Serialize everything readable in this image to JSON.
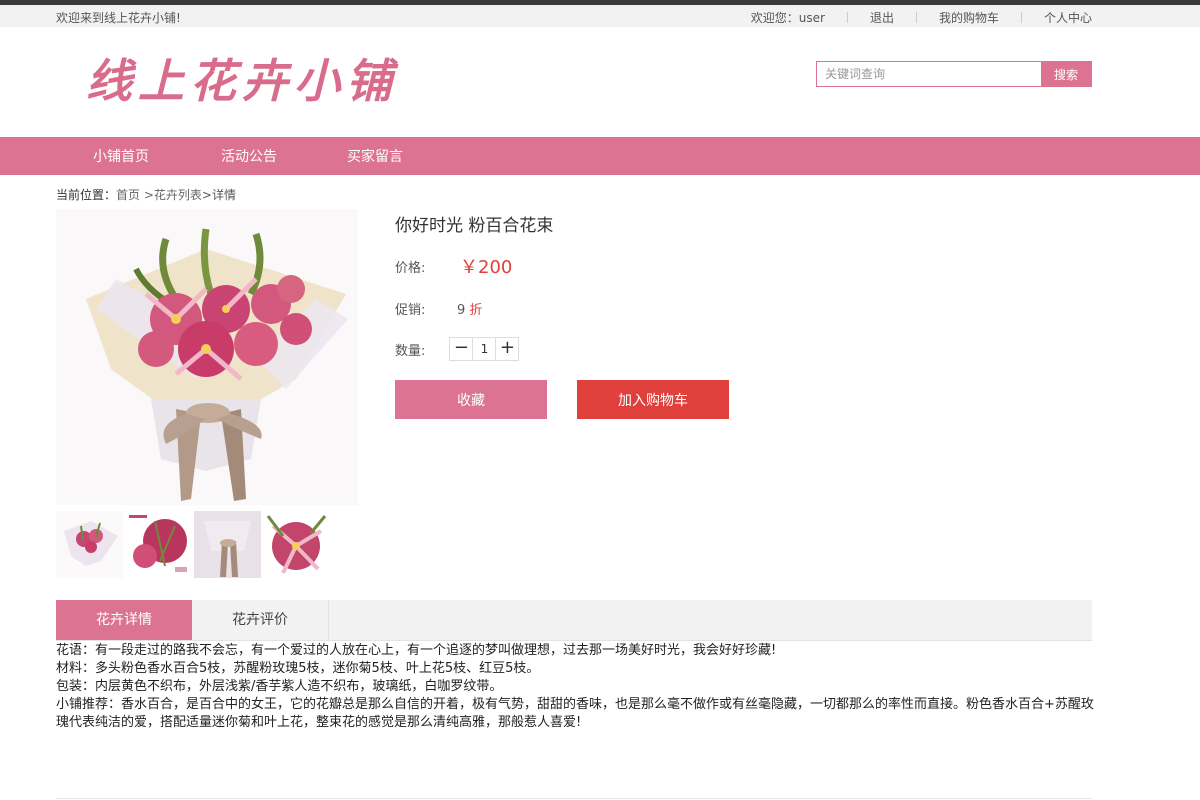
{
  "topbar": {
    "welcome": "欢迎来到线上花卉小铺!",
    "user_greeting": "欢迎您：user",
    "logout": "退出",
    "cart": "我的购物车",
    "account": "个人中心"
  },
  "header": {
    "logo_text": "线上花卉小铺",
    "search": {
      "placeholder": "关键词查询",
      "button": "搜索"
    }
  },
  "nav": {
    "items": [
      "小铺首页",
      "活动公告",
      "买家留言"
    ]
  },
  "breadcrumb": {
    "label": "当前位置：",
    "home": "首页",
    "list": ">花卉列表",
    "current": ">详情"
  },
  "product": {
    "title": "你好时光 粉百合花束",
    "price_label": "价格:",
    "price": "￥200",
    "promo_label": "促销:",
    "promo_number": "9",
    "promo_unit": "折",
    "qty_label": "数量:",
    "qty_minus": "−",
    "qty_value": "1",
    "qty_plus": "+",
    "fav_button": "收藏",
    "cart_button": "加入购物车"
  },
  "tabs": {
    "active": "花卉详情",
    "second": "花卉评价"
  },
  "details": {
    "line1": "花语：有一段走过的路我不会忘，有一个爱过的人放在心上，有一个追逐的梦叫做理想，过去那一场美好时光，我会好好珍藏!",
    "line2": "材料：多头粉色香水百合5枝，苏醒粉玫瑰5枝，迷你菊5枝、叶上花5枝、红豆5枝。",
    "line3": "包装：内层黄色不织布，外层浅紫/香芋紫人造不织布，玻璃纸，白咖罗纹带。",
    "line4": "小铺推荐：香水百合，是百合中的女王，它的花瓣总是那么自信的开着，极有气势，甜甜的香味，也是那么毫不做作或有丝毫隐藏，一切都那么的率性而直接。粉色香水百合+苏醒玫瑰代表纯洁的爱，搭配适量迷你菊和叶上花，整束花的感觉是那么清纯高雅，那般惹人喜爱!"
  },
  "colors": {
    "pink": "#dc7393",
    "red": "#e0403c"
  }
}
